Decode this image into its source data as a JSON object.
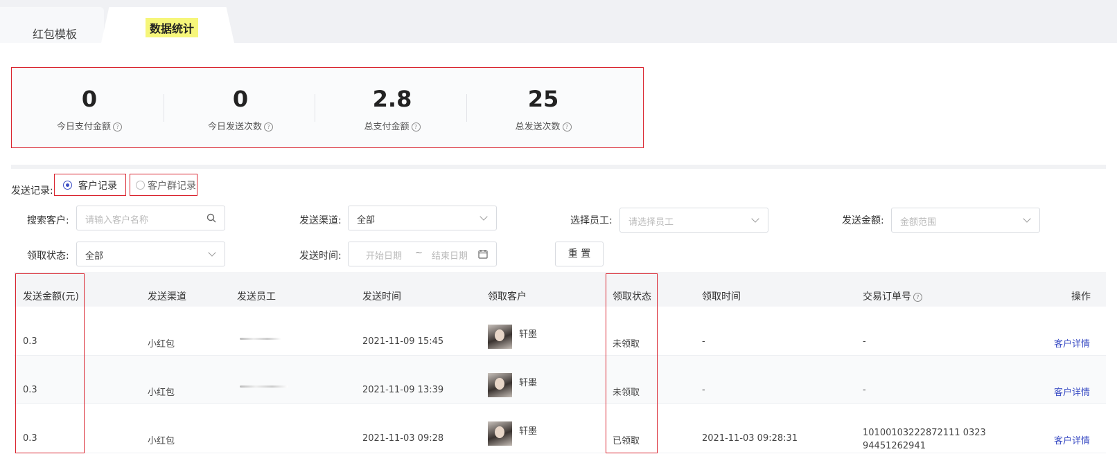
{
  "tabs": [
    {
      "label": "红包模板"
    },
    {
      "label": "数据统计"
    }
  ],
  "stats": [
    {
      "value": "0",
      "label": "今日支付金额"
    },
    {
      "value": "0",
      "label": "今日发送次数"
    },
    {
      "value": "2.8",
      "label": "总支付金额"
    },
    {
      "value": "25",
      "label": "总发送次数"
    }
  ],
  "record": {
    "label": "发送记录:",
    "options": [
      {
        "label": "客户记录",
        "selected": true
      },
      {
        "label": "客户群记录",
        "selected": false
      }
    ]
  },
  "filters": {
    "search_customer": {
      "label": "搜索客户:",
      "placeholder": "请输入客户名称"
    },
    "channel": {
      "label": "发送渠道:",
      "value": "全部"
    },
    "employee": {
      "label": "选择员工:",
      "placeholder": "请选择员工"
    },
    "amount": {
      "label": "发送金额:",
      "placeholder": "金额范围"
    },
    "status": {
      "label": "领取状态:",
      "value": "全部"
    },
    "send_time": {
      "label": "发送时间:",
      "start_placeholder": "开始日期",
      "sep": "~",
      "end_placeholder": "结束日期"
    },
    "reset": "重 置"
  },
  "table": {
    "headers": [
      "发送金额(元)",
      "发送渠道",
      "发送员工",
      "发送时间",
      "领取客户",
      "领取状态",
      "领取时间",
      "交易订单号",
      "操作"
    ],
    "rows": [
      {
        "amount": "0.3",
        "channel": "小红包",
        "time": "2021-11-09 15:45",
        "customer": "轩墨",
        "status": "未领取",
        "claim_time": "-",
        "order_line1": "-",
        "order_line2": "",
        "action": "客户详情"
      },
      {
        "amount": "0.3",
        "channel": "小红包",
        "time": "2021-11-09 13:39",
        "customer": "轩墨",
        "status": "未领取",
        "claim_time": "-",
        "order_line1": "-",
        "order_line2": "",
        "action": "客户详情"
      },
      {
        "amount": "0.3",
        "channel": "小红包",
        "time": "2021-11-03 09:28",
        "customer": "轩墨",
        "status": "已领取",
        "claim_time": "2021-11-03 09:28:31",
        "order_line1": "10100103222872111 0323",
        "order_line2": "94451262941",
        "action": "客户详情"
      }
    ]
  },
  "colors": {
    "accent": "#3b4dc4",
    "highlight": "#d9232e",
    "tab_highlight": "#f6f67a"
  },
  "icons": [
    "search-icon",
    "chevron-down-icon",
    "calendar-icon",
    "help-circle-icon"
  ]
}
